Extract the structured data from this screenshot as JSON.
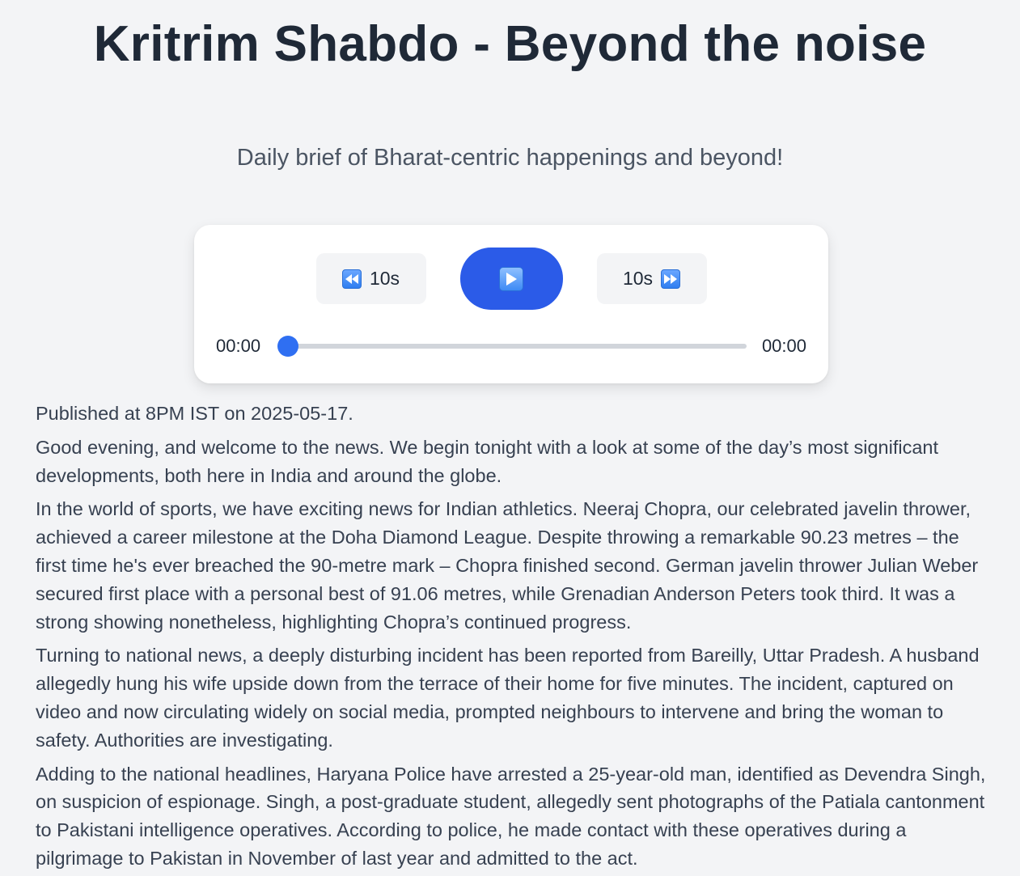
{
  "header": {
    "title": "Kritrim Shabdo - Beyond the noise",
    "subtitle": "Daily brief of Bharat-centric happenings and beyond!"
  },
  "player": {
    "rewind_label": "10s",
    "rewind_icon": "rewind-icon",
    "play_icon": "play-icon",
    "forward_label": "10s",
    "forward_icon": "fast-forward-icon",
    "current_time": "00:00",
    "total_time": "00:00",
    "progress": 0,
    "accent_color": "#2b5be8"
  },
  "article": {
    "published": "Published at 8PM IST on 2025-05-17.",
    "paragraphs": [
      "Good evening, and welcome to the news. We begin tonight with a look at some of the day’s most significant developments, both here in India and around the globe.",
      "In the world of sports, we have exciting news for Indian athletics. Neeraj Chopra, our celebrated javelin thrower, achieved a career milestone at the Doha Diamond League. Despite throwing a remarkable 90.23 metres – the first time he's ever breached the 90-metre mark – Chopra finished second. German javelin thrower Julian Weber secured first place with a personal best of 91.06 metres, while Grenadian Anderson Peters took third. It was a strong showing nonetheless, highlighting Chopra’s continued progress.",
      "Turning to national news, a deeply disturbing incident has been reported from Bareilly, Uttar Pradesh. A husband allegedly hung his wife upside down from the terrace of their home for five minutes. The incident, captured on video and now circulating widely on social media, prompted neighbours to intervene and bring the woman to safety. Authorities are investigating.",
      "Adding to the national headlines, Haryana Police have arrested a 25-year-old man, identified as Devendra Singh, on suspicion of espionage. Singh, a post-graduate student, allegedly sent photographs of the Patiala cantonment to Pakistani intelligence operatives. According to police, he made contact with these operatives during a pilgrimage to Pakistan in November of last year and admitted to the act."
    ]
  }
}
